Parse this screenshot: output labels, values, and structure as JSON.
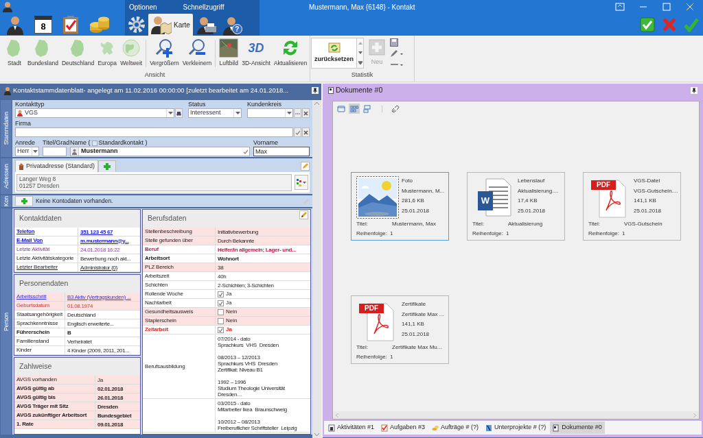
{
  "window": {
    "title": "Mustermann, Max {6148} - Kontakt"
  },
  "ribbon_tabs": [
    {
      "selected": false
    },
    {
      "icon_text": "8",
      "selected": false
    },
    {
      "selected": false
    },
    {
      "selected": false
    }
  ],
  "context_tab_group": {
    "labels": [
      "Optionen",
      "Schnellzugriff"
    ],
    "tabs": [
      {
        "selected": false
      },
      {
        "label": "Karte",
        "selected": true
      },
      {
        "selected": false
      },
      {
        "icon_text": "?",
        "selected": false
      }
    ]
  },
  "ribbon_groups": [
    {
      "label": "Ansicht",
      "sections": [
        [
          {
            "label": "Stadt",
            "disabled": false
          },
          {
            "label": "Bundesland",
            "disabled": false
          },
          {
            "label": "Deutschland",
            "disabled": false
          },
          {
            "label": "Europa",
            "disabled": false
          },
          {
            "label": "Weltweit",
            "disabled": false
          }
        ],
        [
          {
            "label": "Vergrößern",
            "disabled": false
          },
          {
            "label": "Verkleinern",
            "disabled": false
          }
        ],
        [
          {
            "label": "Luftbild",
            "disabled": false
          },
          {
            "label": "3D-Ansicht",
            "icon_text": "3D",
            "disabled": false
          },
          {
            "label": "Aktualisieren",
            "disabled": false
          }
        ]
      ]
    },
    {
      "label": "Statistik",
      "gallery": {
        "label": "zurücksetzen"
      },
      "buttons": [
        {
          "label": "Neu",
          "disabled": true
        }
      ]
    }
  ],
  "contact_sheet": {
    "title": "Kontaktstammdatenblatt- angelegt am 11.02.2016 00:00:00 [zuletzt bearbeitet am 24.01.2018...",
    "side_tabs": [
      "Stammdaten",
      "Adressen",
      "Kon",
      "Person"
    ],
    "stammdaten": {
      "kontakttyp": {
        "label": "Kontakttyp",
        "value": "VGS"
      },
      "status": {
        "label": "Status",
        "value": "Interessent"
      },
      "kundenkreis": {
        "label": "Kundenkreis"
      },
      "firma": {
        "label": "Firma"
      },
      "anrede": {
        "label": "Anrede",
        "value": "Herr"
      },
      "titel": {
        "label": "Titel/Grad"
      },
      "name": {
        "label": "Name (",
        "checkbox_label": "Standardkontakt )",
        "checked": false,
        "value": "Mustermann"
      },
      "vorname": {
        "label": "Vorname",
        "value": "Max"
      }
    },
    "adressen": {
      "tab": "Privatadresse (Standard)",
      "lines": [
        "Langer Weg 8",
        "01257 Dresden"
      ]
    },
    "kontodaten": {
      "message": "Keine Kontodaten vorhanden."
    },
    "left_cards": [
      {
        "title": "Kontaktdaten",
        "rows": [
          {
            "kind": "text",
            "label": "Telefon",
            "value": "351 123 45 67",
            "color": "#1414d8",
            "bold": true,
            "underlined": true,
            "highlighted": false
          },
          {
            "kind": "text",
            "label": "E-Mail Von",
            "value": "m.mustermann@y...",
            "color": "#1414d8",
            "bold": true,
            "underlined": true,
            "highlighted": false
          },
          {
            "kind": "muted",
            "label": "Letzte Aktivität",
            "value": "24.01.2018 16:22",
            "bold": false,
            "underlined": false,
            "highlighted": false
          },
          {
            "kind": "text",
            "label": "Letzte Aktivitätskategorie",
            "value": "Bewerbung noch akt...",
            "bold": false,
            "underlined": false,
            "highlighted": false
          },
          {
            "kind": "text",
            "label": "Letzter Bearbeiter",
            "value": "Administrator {0}",
            "bold": false,
            "underlined": true,
            "highlighted": false
          }
        ]
      },
      {
        "title": "Personendaten",
        "rows": [
          {
            "kind": "link",
            "label": "Arbeitsschritt",
            "value": "B3 Aktiv (Vertragskunden) ...",
            "bold": false,
            "underlined": true,
            "highlighted": true
          },
          {
            "kind": "warning",
            "label": "Geburtsdatum",
            "value": "01.08.1974",
            "bold": false,
            "underlined": false,
            "highlighted": true
          },
          {
            "kind": "text",
            "label": "Staatsangehörigkeit",
            "value": "Deutschland",
            "bold": false,
            "underlined": false,
            "highlighted": false
          },
          {
            "kind": "text",
            "label": "Sprachkenntnisse",
            "value": "Englisch erweiterte...",
            "bold": false,
            "underlined": false,
            "highlighted": false
          },
          {
            "kind": "text",
            "label": "Führerschein",
            "value": "B",
            "bold": true,
            "underlined": false,
            "highlighted": false
          },
          {
            "kind": "text",
            "label": "Familienstand",
            "value": "Verheiratet",
            "bold": false,
            "underlined": false,
            "highlighted": false
          },
          {
            "kind": "text",
            "label": "Kinder",
            "value": "4 Kinder (2009, 2011, 201...",
            "bold": false,
            "underlined": false,
            "highlighted": false
          }
        ]
      },
      {
        "title": "Zahlweise",
        "rows": [
          {
            "kind": "text",
            "label": "AVGS vorhanden",
            "value": "Ja",
            "bold": false,
            "underlined": false,
            "highlighted": true
          },
          {
            "kind": "text",
            "label": "AVGS gültig ab",
            "value": "02.01.2018",
            "bold": true,
            "underlined": false,
            "highlighted": true
          },
          {
            "kind": "text",
            "label": "AVGS gültig bis",
            "value": "26.01.2018",
            "bold": true,
            "underlined": false,
            "highlighted": true
          },
          {
            "kind": "text",
            "label": "AVGS Träger mit Sitz",
            "value": "Dresden",
            "bold": true,
            "underlined": false,
            "highlighted": true
          },
          {
            "kind": "text",
            "label": "AVGS zukünftiger Arbeitsort",
            "value": "Bundesgebiet",
            "bold": true,
            "underlined": false,
            "highlighted": true
          },
          {
            "kind": "text",
            "label": "1. Rate",
            "value": "09.01.2018",
            "bold": true,
            "underlined": false,
            "highlighted": true
          }
        ]
      }
    ],
    "right_cards": [
      {
        "title": "Berufsdaten",
        "rows": [
          {
            "kind": "text",
            "label": "Stellenbeschreibung",
            "value": "Initiativbewerbung",
            "bold": false,
            "underlined": false,
            "highlighted": true
          },
          {
            "kind": "text",
            "label": "Stelle gefunden über",
            "value": "Durch Bekannte",
            "bold": false,
            "underlined": false,
            "highlighted": true
          },
          {
            "kind": "text",
            "label": "Beruf",
            "value": "Helfer/in allgemein; Lager- und...",
            "color": "#c4184c",
            "bold": true,
            "underlined": false,
            "highlighted": false
          },
          {
            "kind": "text",
            "label": "Arbeitsort",
            "value": "Wohnort",
            "bold": true,
            "underlined": false,
            "highlighted": false
          },
          {
            "kind": "text",
            "label": "PLZ Bereich",
            "value": "38",
            "bold": false,
            "underlined": false,
            "highlighted": true
          },
          {
            "kind": "text",
            "label": "Arbeitszeit",
            "value": "40h",
            "bold": false,
            "underlined": false,
            "highlighted": false
          },
          {
            "kind": "text",
            "label": "Schichten",
            "value": "2-Schichten; 3-Schichten",
            "bold": false,
            "underlined": false,
            "highlighted": false
          },
          {
            "kind": "check",
            "label": "Rollende Woche",
            "value": "Ja",
            "checked": true,
            "bold": false,
            "underlined": false,
            "highlighted": false
          },
          {
            "kind": "check",
            "label": "Nachtarbeit",
            "value": "Ja",
            "checked": true,
            "bold": false,
            "underlined": false,
            "highlighted": false
          },
          {
            "kind": "check",
            "label": "Gesundheitsausweis",
            "value": "Nein",
            "checked": false,
            "bold": false,
            "underlined": false,
            "highlighted": true
          },
          {
            "kind": "check",
            "label": "Staplerschein",
            "value": "Nein",
            "checked": false,
            "bold": false,
            "underlined": false,
            "highlighted": true
          },
          {
            "kind": "check",
            "label": "Zeitarbeit",
            "value": "Ja",
            "checked": true,
            "color": "#ee2020",
            "bold": true,
            "underlined": false,
            "highlighted": false
          },
          {
            "kind": "text",
            "label": "Berufsausbildung",
            "value": "07/2014 - dato\nSprachkurs  VHS  Dresden\n\n08/2013 – 12/2013\nSprachkurs VHS  Dresden\nZertifikat: Niveau B1\n\n1992 – 1996\nStudium Theologie Universität\nDresden…",
            "bold": false,
            "underlined": false,
            "highlighted": false
          },
          {
            "kind": "text",
            "value": "03/2015 - dato\nMitarbeiter Ikea  Braunschweig\n\n10/2012 – 08/2013\nFreiberuflicher Schriftsteller  Leipzig",
            "bold": false,
            "underlined": false,
            "highlighted": false
          }
        ]
      }
    ]
  },
  "documents_panel": {
    "title": "Dokumente #0",
    "view_buttons": [
      {
        "selected": false
      },
      {
        "selected": true
      },
      {
        "selected": false
      }
    ],
    "documents": [
      {
        "kind": "picture",
        "name": "Foto",
        "description": "Mustermann, M...",
        "size": "281,6 KB",
        "date": "25.01.2018",
        "title_label": "Titel:",
        "title": "Mustermann, Max",
        "order_label": "Reihenfolge:",
        "order": "1",
        "selected": true
      },
      {
        "kind": "word",
        "badge": "W",
        "name": "Lebenslauf",
        "description": "Aktualisierung....",
        "size": "17,4 KB",
        "date": "25.01.2018",
        "title_label": "Titel:",
        "title": "Aktualisierung",
        "order_label": "Reihenfolge:",
        "order": "1",
        "selected": false
      },
      {
        "kind": "pdf",
        "badge": "PDF",
        "name": "VGS-Datei",
        "description": "VGS-Gutschein....",
        "size": "141,1 KB",
        "date": "25.01.2018",
        "title_label": "Titel:",
        "title": "VGS-Gutschein",
        "order_label": "Reihenfolge:",
        "order": "1",
        "selected": false
      },
      {
        "kind": "pdf",
        "badge": "PDF",
        "name": "Zertifikate",
        "description": "Zertifikate Max ...",
        "size": "141,1 KB",
        "date": "25.01.2018",
        "title_label": "Titel:",
        "title": "Zertifikate Max Mu...",
        "order_label": "Reihenfolge:",
        "order": "1",
        "selected": false
      }
    ],
    "bottom_tabs": [
      {
        "label": "Aktivitäten #1",
        "selected": false
      },
      {
        "label": "Aufgaben #3",
        "selected": false
      },
      {
        "label": "Aufträge # (?)",
        "selected": false
      },
      {
        "label": "Unterprojekte # (?)",
        "selected": false
      },
      {
        "label": "Dokumente #0",
        "selected": true
      }
    ]
  }
}
